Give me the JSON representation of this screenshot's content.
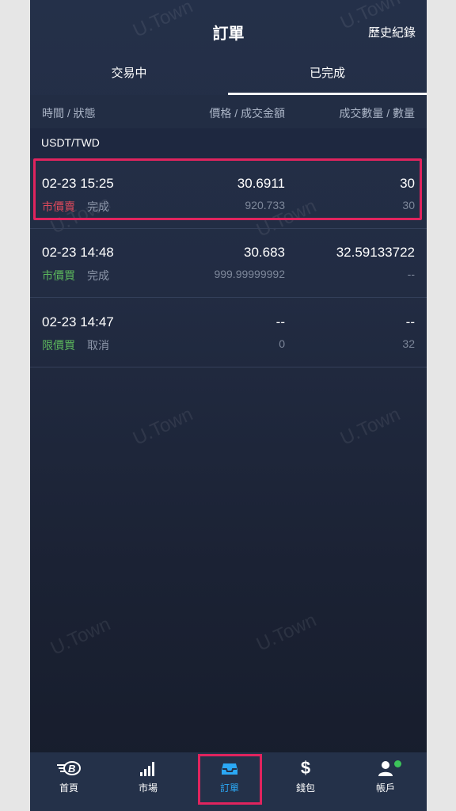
{
  "header": {
    "title": "訂單",
    "history_label": "歷史紀錄"
  },
  "tabs": [
    {
      "label": "交易中",
      "active": false
    },
    {
      "label": "已完成",
      "active": true
    }
  ],
  "columns": {
    "time_status": "時間 / 狀態",
    "price_amount": "價格 / 成交金額",
    "filled_quantity": "成交數量 / 數量"
  },
  "section": {
    "pair": "USDT/TWD"
  },
  "orders": [
    {
      "time": "02-23 15:25",
      "side": "市價賣",
      "status": "完成",
      "price": "30.6911",
      "amount": "920.733",
      "filled": "30",
      "quantity": "30"
    },
    {
      "time": "02-23 14:48",
      "side": "市價買",
      "status": "完成",
      "price": "30.683",
      "amount": "999.99999992",
      "filled": "32.59133722",
      "quantity": "--"
    },
    {
      "time": "02-23 14:47",
      "side": "限價買",
      "status": "取消",
      "price": "--",
      "amount": "0",
      "filled": "--",
      "quantity": "32"
    }
  ],
  "watermark": "U.Town",
  "nav": [
    {
      "label": "首頁",
      "icon": "bitopro-logo-icon"
    },
    {
      "label": "市場",
      "icon": "signal-bars-icon"
    },
    {
      "label": "訂單",
      "icon": "inbox-tray-icon",
      "active": true
    },
    {
      "label": "錢包",
      "icon": "dollar-sign-icon"
    },
    {
      "label": "帳戶",
      "icon": "user-icon"
    }
  ],
  "colors": {
    "sell": "#e04a5c",
    "buy": "#5cb85c",
    "active_nav": "#2ba8f5",
    "highlight": "#e0245e"
  }
}
